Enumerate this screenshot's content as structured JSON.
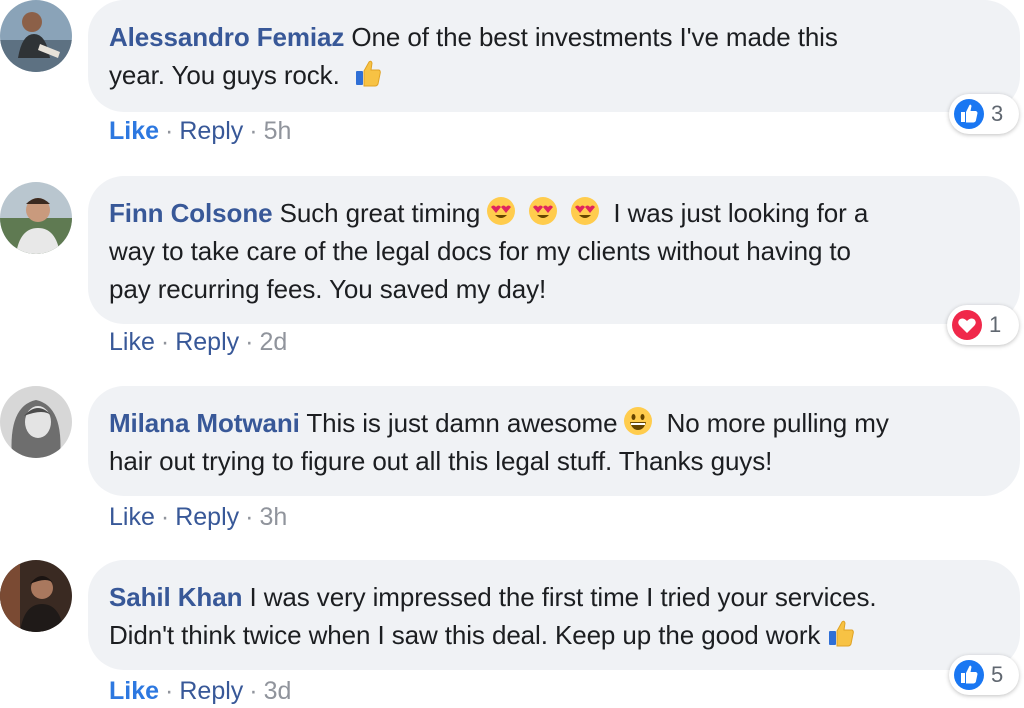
{
  "comments": [
    {
      "author": "Alessandro Femiaz",
      "text_1": "One of the best investments I've made this",
      "text_2": "year. You guys rock.",
      "like_label": "Like",
      "reply_label": "Reply",
      "time": "5h",
      "reaction_type": "like-icon",
      "reaction_count": "3"
    },
    {
      "author": "Finn Colsone",
      "text_1a": "Such great timing",
      "text_1b": "I was just looking for a",
      "text_2": "way to take care of the legal docs for my clients without having to",
      "text_3": "pay recurring fees. You saved my day!",
      "like_label": "Like",
      "reply_label": "Reply",
      "time": "2d",
      "reaction_type": "heart-icon",
      "reaction_count": "1"
    },
    {
      "author": "Milana Motwani",
      "text_1a": "This is just damn awesome",
      "text_1b": "No more pulling my",
      "text_2": "hair out trying to figure out all this legal stuff. Thanks guys!",
      "like_label": "Like",
      "reply_label": "Reply",
      "time": "3h"
    },
    {
      "author": "Sahil Khan",
      "text_1": "I was very impressed the first time I tried your services.",
      "text_2": "Didn't think twice when I saw this deal. Keep up the good work",
      "like_label": "Like",
      "reply_label": "Reply",
      "time": "3d",
      "reaction_type": "like-icon",
      "reaction_count": "5"
    }
  ],
  "separator": "·",
  "colors": {
    "author": "#385898",
    "bubble": "#f0f2f5",
    "like_active": "#2d78e0",
    "meta": "#90949c"
  }
}
